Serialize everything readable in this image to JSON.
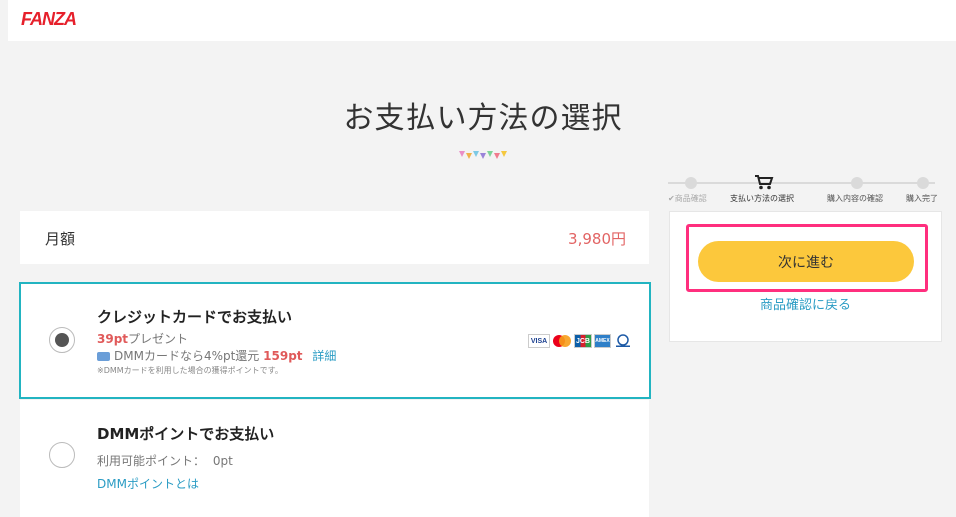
{
  "header": {
    "logo": "FANZA"
  },
  "page": {
    "title": "お支払い方法の選択"
  },
  "steps": [
    {
      "label": "商品確認",
      "state": "done"
    },
    {
      "label": "支払い方法の選択",
      "state": "active"
    },
    {
      "label": "購入内容の確認",
      "state": "pending"
    },
    {
      "label": "購入完了",
      "state": "pending"
    }
  ],
  "amount": {
    "label": "月額",
    "value": "3,980円"
  },
  "payment_options": {
    "credit": {
      "title": "クレジットカードでお支払い",
      "points_value": "39pt",
      "points_suffix": "プレゼント",
      "dmm_card_text": "DMMカードなら4%pt還元",
      "dmm_card_points": "159pt",
      "detail_link": "詳細",
      "note": "※DMMカードを利用した場合の獲得ポイントです。",
      "selected": true,
      "brands": [
        "VISA",
        "MC",
        "JCB",
        "AMEX",
        "Diners"
      ]
    },
    "dmm_points": {
      "title": "DMMポイントでお支払い",
      "available_label": "利用可能ポイント：",
      "available_value": "0pt",
      "info_link": "DMMポイントとは",
      "selected": false
    }
  },
  "side": {
    "next_button": "次に進む",
    "back_link": "商品確認に戻る"
  },
  "colors": {
    "accent_teal": "#22b4c1",
    "button_yellow": "#fcc83c",
    "highlight_pink": "#ff2f7e",
    "price_red": "#e26464"
  }
}
